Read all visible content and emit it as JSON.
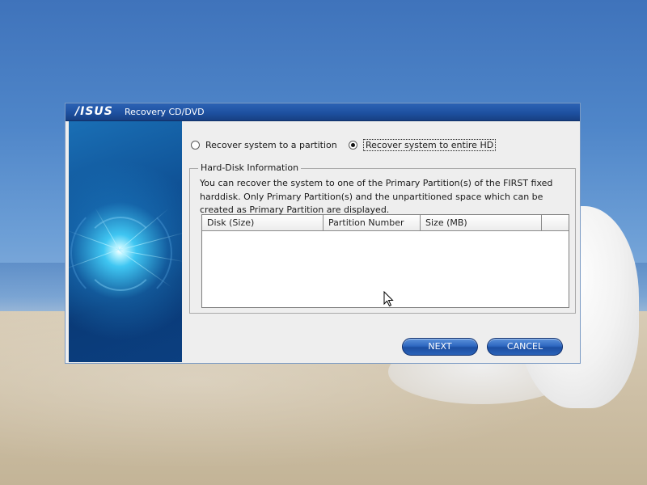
{
  "window": {
    "logo": "/ISUS",
    "title": "Recovery CD/DVD"
  },
  "options": {
    "partition_label": "Recover system to a partition",
    "entire_label": "Recover system to entire HD",
    "selected": "entire"
  },
  "hdd_group": {
    "legend": "Hard-Disk Information",
    "description": "You can recover the system to one of the Primary Partition(s) of the FIRST fixed harddisk. Only Primary Partition(s) and the unpartitioned space which can be created as Primary Partition are displayed."
  },
  "table": {
    "columns": [
      "Disk (Size)",
      "Partition Number",
      "Size (MB)",
      ""
    ],
    "rows": []
  },
  "buttons": {
    "next": "NEXT",
    "cancel": "CANCEL"
  },
  "colors": {
    "titlebar": "#1d4f9e",
    "button": "#2f68c0",
    "dialog_bg": "#eeeeee"
  },
  "icons": [
    "asus-logo",
    "radio-unchecked-icon",
    "radio-checked-icon",
    "mouse-cursor-icon"
  ]
}
